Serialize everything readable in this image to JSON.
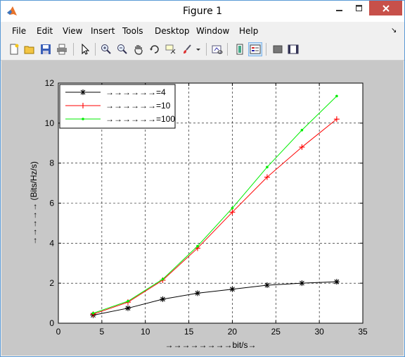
{
  "window": {
    "title": "Figure 1"
  },
  "menu": [
    "File",
    "Edit",
    "View",
    "Insert",
    "Tools",
    "Desktop",
    "Window",
    "Help"
  ],
  "toolbar": [
    "new-figure-icon",
    "open-file-icon",
    "save-icon",
    "print-icon",
    "pointer-icon",
    "zoom-in-icon",
    "zoom-out-icon",
    "pan-icon",
    "rotate-3d-icon",
    "data-cursor-icon",
    "brush-icon",
    "brush-dropdown-icon",
    "link-plot-icon",
    "colorbar-icon",
    "legend-icon",
    "hide-plot-tools-icon",
    "show-plot-tools-icon"
  ],
  "chart_data": {
    "type": "line",
    "title": "",
    "xlabel": "→→→→→→→→bit/s→",
    "ylabel": "→→→→→ (Bits/Hz/s)",
    "xlim": [
      0,
      35
    ],
    "ylim": [
      0,
      12
    ],
    "xticks": [
      0,
      5,
      10,
      15,
      20,
      25,
      30,
      35
    ],
    "yticks": [
      0,
      2,
      4,
      6,
      8,
      10,
      12
    ],
    "grid": true,
    "legend_position": "top-left",
    "x": [
      4,
      8,
      12,
      16,
      20,
      24,
      28,
      32
    ],
    "series": [
      {
        "name": "→→→→→→=4",
        "color": "#000000",
        "marker": "asterisk",
        "values": [
          0.4,
          0.75,
          1.2,
          1.5,
          1.7,
          1.9,
          2.0,
          2.07
        ]
      },
      {
        "name": "→→→→→→=10",
        "color": "#ff0000",
        "marker": "plus",
        "values": [
          0.45,
          1.05,
          2.15,
          3.75,
          5.55,
          7.3,
          8.8,
          10.2
        ]
      },
      {
        "name": "→→→→→→=100",
        "color": "#00ee00",
        "marker": "dot",
        "values": [
          0.5,
          1.1,
          2.2,
          3.85,
          5.75,
          7.8,
          9.65,
          11.35
        ]
      }
    ]
  }
}
